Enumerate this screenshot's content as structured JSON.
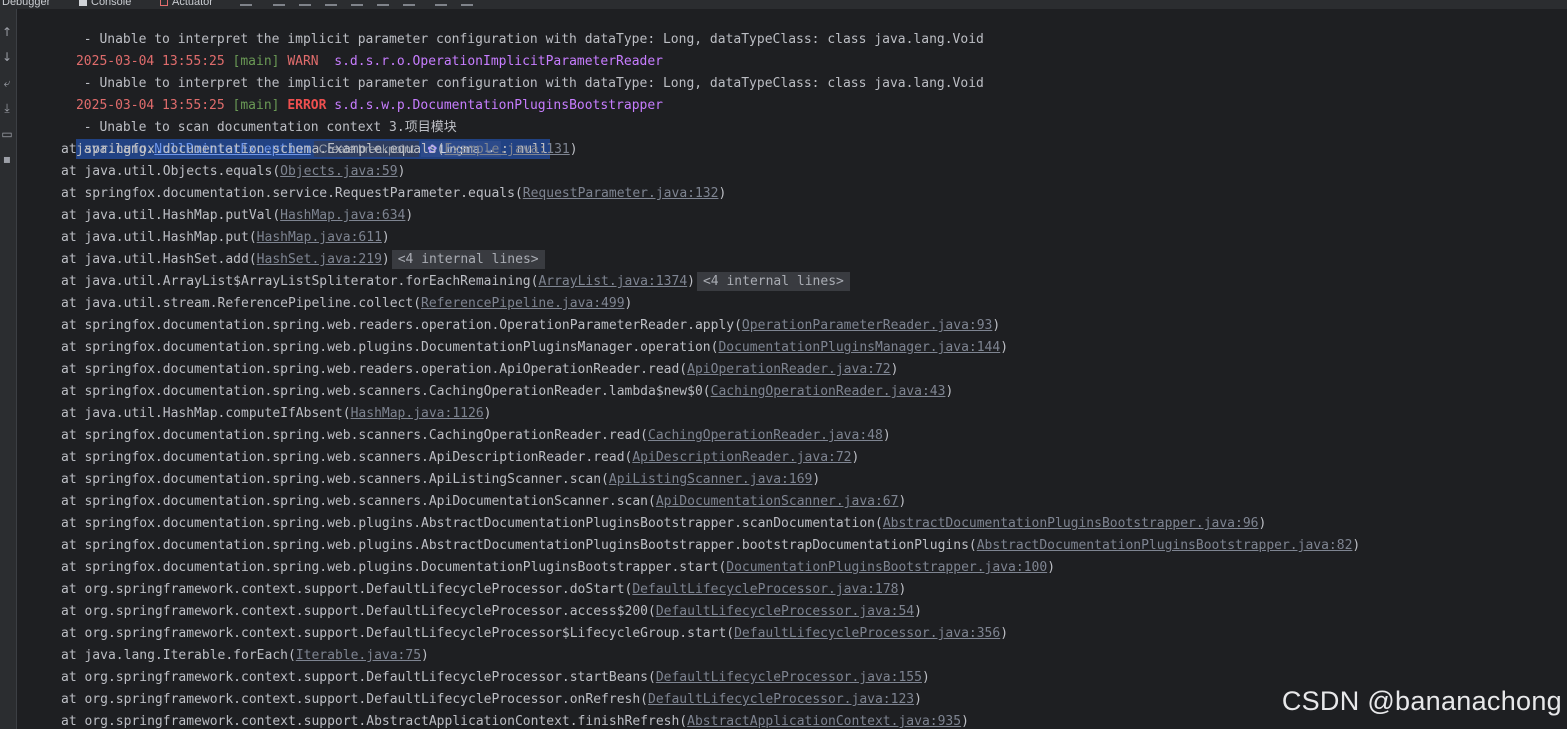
{
  "tabs": [
    {
      "label": "Debugger",
      "icon": "debugger-icon"
    },
    {
      "label": "Console",
      "icon": "console-icon"
    },
    {
      "label": "Actuator",
      "icon": "actuator-icon"
    }
  ],
  "gutter_icons": [
    "arrow-up-icon",
    "arrow-down-icon",
    "soft-wrap-icon",
    "scroll-to-end-icon",
    "print-icon",
    "trash-icon"
  ],
  "log": {
    "line0": " - Unable to interpret the implicit parameter configuration with dataType: Long, dataTypeClass: class java.lang.Void",
    "line1": {
      "ts": "2025-03-04 13:55:25",
      "thread": "[main]",
      "level": "WARN ",
      "logger": "s.d.s.r.o.OperationImplicitParameterReader"
    },
    "line2": " - Unable to interpret the implicit parameter configuration with dataType: Long, dataTypeClass: class java.lang.Void",
    "line3": {
      "ts": "2025-03-04 13:55:25",
      "thread": "[main]",
      "level": "ERROR",
      "logger": "s.d.s.w.p.DocumentationPluginsBootstrapper"
    },
    "line4": " - Unable to scan documentation context 3.项目模块",
    "exception": {
      "prefix": "java.lang.",
      "name": "NullPointerException",
      "hint": "Create breakpoint",
      "lingma": "Lingma",
      "lingma_arrow": "→",
      "suffix": ": null"
    }
  },
  "stack": [
    {
      "text": "at springfox.documentation.schema.Example.equals(",
      "link": "Example.java:131",
      "after": ")"
    },
    {
      "text": "at java.util.Objects.equals(",
      "link": "Objects.java:59",
      "after": ")"
    },
    {
      "text": "at springfox.documentation.service.RequestParameter.equals(",
      "link": "RequestParameter.java:132",
      "after": ")"
    },
    {
      "text": "at java.util.HashMap.putVal(",
      "link": "HashMap.java:634",
      "after": ")"
    },
    {
      "text": "at java.util.HashMap.put(",
      "link": "HashMap.java:611",
      "after": ")"
    },
    {
      "text": "at java.util.HashSet.add(",
      "link": "HashSet.java:219",
      "after": ")",
      "internal": "<4 internal lines>",
      "fold": "+"
    },
    {
      "text": "at java.util.ArrayList$ArrayListSpliterator.forEachRemaining(",
      "link": "ArrayList.java:1374",
      "after": ")",
      "internal": "<4 internal lines>",
      "fold": "+"
    },
    {
      "text": "at java.util.stream.ReferencePipeline.collect(",
      "link": "ReferencePipeline.java:499",
      "after": ")"
    },
    {
      "text": "at springfox.documentation.spring.web.readers.operation.OperationParameterReader.apply(",
      "link": "OperationParameterReader.java:93",
      "after": ")"
    },
    {
      "text": "at springfox.documentation.spring.web.plugins.DocumentationPluginsManager.operation(",
      "link": "DocumentationPluginsManager.java:144",
      "after": ")"
    },
    {
      "text": "at springfox.documentation.spring.web.readers.operation.ApiOperationReader.read(",
      "link": "ApiOperationReader.java:72",
      "after": ")"
    },
    {
      "text": "at springfox.documentation.spring.web.scanners.CachingOperationReader.lambda$new$0(",
      "link": "CachingOperationReader.java:43",
      "after": ")"
    },
    {
      "text": "at java.util.HashMap.computeIfAbsent(",
      "link": "HashMap.java:1126",
      "after": ")"
    },
    {
      "text": "at springfox.documentation.spring.web.scanners.CachingOperationReader.read(",
      "link": "CachingOperationReader.java:48",
      "after": ")"
    },
    {
      "text": "at springfox.documentation.spring.web.scanners.ApiDescriptionReader.read(",
      "link": "ApiDescriptionReader.java:72",
      "after": ")"
    },
    {
      "text": "at springfox.documentation.spring.web.scanners.ApiListingScanner.scan(",
      "link": "ApiListingScanner.java:169",
      "after": ")"
    },
    {
      "text": "at springfox.documentation.spring.web.scanners.ApiDocumentationScanner.scan(",
      "link": "ApiDocumentationScanner.java:67",
      "after": ")"
    },
    {
      "text": "at springfox.documentation.spring.web.plugins.AbstractDocumentationPluginsBootstrapper.scanDocumentation(",
      "link": "AbstractDocumentationPluginsBootstrapper.java:96",
      "after": ")"
    },
    {
      "text": "at springfox.documentation.spring.web.plugins.AbstractDocumentationPluginsBootstrapper.bootstrapDocumentationPlugins(",
      "link": "AbstractDocumentationPluginsBootstrapper.java:82",
      "after": ")"
    },
    {
      "text": "at springfox.documentation.spring.web.plugins.DocumentationPluginsBootstrapper.start(",
      "link": "DocumentationPluginsBootstrapper.java:100",
      "after": ")"
    },
    {
      "text": "at org.springframework.context.support.DefaultLifecycleProcessor.doStart(",
      "link": "DefaultLifecycleProcessor.java:178",
      "after": ")"
    },
    {
      "text": "at org.springframework.context.support.DefaultLifecycleProcessor.access$200(",
      "link": "DefaultLifecycleProcessor.java:54",
      "after": ")"
    },
    {
      "text": "at org.springframework.context.support.DefaultLifecycleProcessor$LifecycleGroup.start(",
      "link": "DefaultLifecycleProcessor.java:356",
      "after": ")"
    },
    {
      "text": "at java.lang.Iterable.forEach(",
      "link": "Iterable.java:75",
      "after": ")"
    },
    {
      "text": "at org.springframework.context.support.DefaultLifecycleProcessor.startBeans(",
      "link": "DefaultLifecycleProcessor.java:155",
      "after": ")"
    },
    {
      "text": "at org.springframework.context.support.DefaultLifecycleProcessor.onRefresh(",
      "link": "DefaultLifecycleProcessor.java:123",
      "after": ")"
    },
    {
      "text": "at org.springframework.context.support.AbstractApplicationContext.finishRefresh(",
      "link": "AbstractApplicationContext.java:935",
      "after": ")"
    }
  ],
  "watermark": "CSDN @bananachong",
  "colors": {
    "background": "#1e1f22",
    "error": "#ef4f4f",
    "timestamp": "#e06c6c",
    "thread": "#6a9955",
    "logger": "#c77dff",
    "selection": "#214283"
  }
}
